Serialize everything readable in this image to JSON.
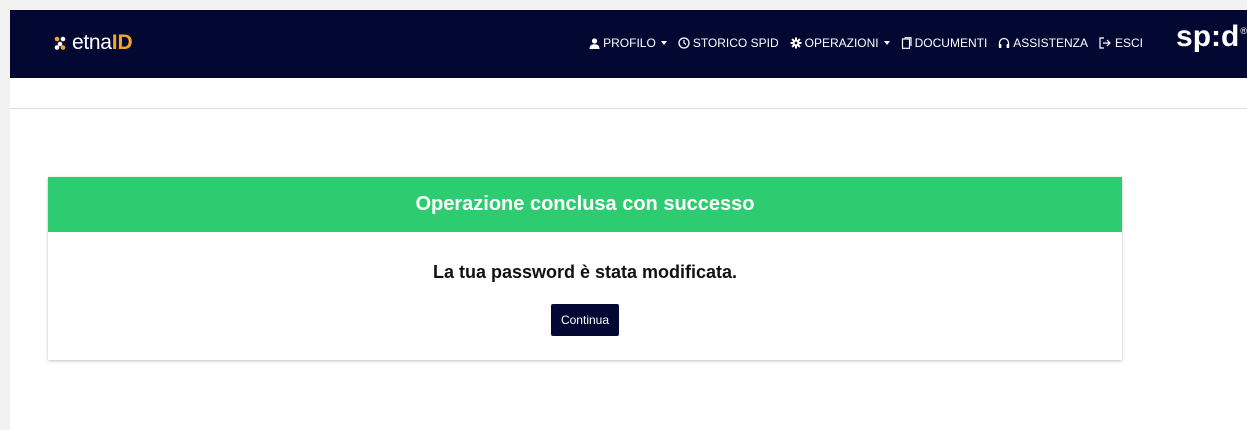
{
  "brand": {
    "prefix": "etna",
    "accent": "ID"
  },
  "nav": {
    "items": [
      {
        "label": "PROFILO",
        "icon": "user-icon",
        "dropdown": true
      },
      {
        "label": "STORICO SPID",
        "icon": "clock-icon",
        "dropdown": false
      },
      {
        "label": "OPERAZIONI",
        "icon": "gear-icon",
        "dropdown": true
      },
      {
        "label": "DOCUMENTI",
        "icon": "document-icon",
        "dropdown": false
      },
      {
        "label": "ASSISTENZA",
        "icon": "headset-icon",
        "dropdown": false
      },
      {
        "label": "ESCI",
        "icon": "logout-icon",
        "dropdown": false
      }
    ]
  },
  "spid": {
    "text": "sp:d",
    "registered": "®"
  },
  "card": {
    "header": "Operazione conclusa con successo",
    "message": "La tua password è stata modificata.",
    "button_label": "Continua"
  },
  "colors": {
    "navbar": "#030833",
    "success": "#2ecc71",
    "brand_accent": "#f6a623",
    "button": "#030833"
  }
}
